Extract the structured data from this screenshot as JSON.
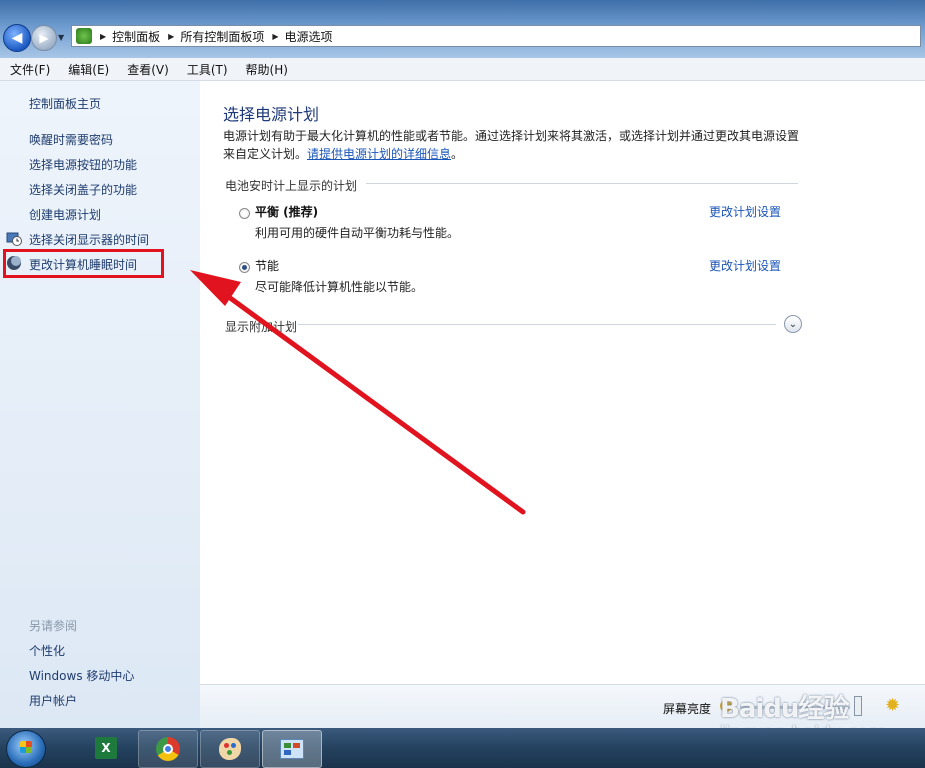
{
  "address_bar": {
    "crumbs": [
      "控制面板",
      "所有控制面板项",
      "电源选项"
    ]
  },
  "menu": [
    "文件(F)",
    "编辑(E)",
    "查看(V)",
    "工具(T)",
    "帮助(H)"
  ],
  "sidebar": {
    "home": "控制面板主页",
    "links": [
      "唤醒时需要密码",
      "选择电源按钮的功能",
      "选择关闭盖子的功能",
      "创建电源计划",
      "选择关闭显示器的时间",
      "更改计算机睡眠时间"
    ],
    "see_also_title": "另请参阅",
    "see_also": [
      "个性化",
      "Windows 移动中心",
      "用户帐户"
    ]
  },
  "main": {
    "title": "选择电源计划",
    "description_line1": "电源计划有助于最大化计算机的性能或者节能。通过选择计划来将其激活，或选择计划并通过更改其电源设置",
    "description_prefix": "来自定义计划。",
    "description_link": "请提供电源计划的详细信息",
    "description_suffix": "。",
    "section_label": "电池安时计上显示的计划",
    "plans": [
      {
        "name": "平衡 (推荐)",
        "description": "利用可用的硬件自动平衡功耗与性能。",
        "link": "更改计划设置",
        "selected": false
      },
      {
        "name": "节能",
        "description": "尽可能降低计算机性能以节能。",
        "link": "更改计划设置",
        "selected": true
      }
    ],
    "more_plans_label": "显示附加计划"
  },
  "bottom": {
    "brightness_label": "屏幕亮度"
  },
  "watermark": {
    "logo": "Baidu经验",
    "url": "jingyan.baidu.com"
  },
  "colors": {
    "highlight": "#e0131e",
    "link": "#1a55b8",
    "title": "#1f3a7a"
  }
}
